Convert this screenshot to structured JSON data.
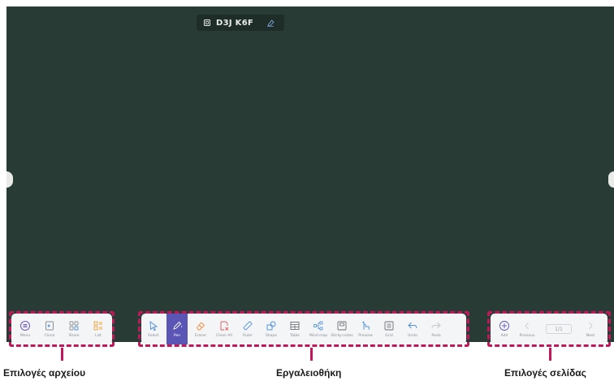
{
  "room": {
    "code": "D3J K6F",
    "code_icon": "copy-icon",
    "edit_icon": "eraser-icon"
  },
  "file_options": {
    "items": [
      {
        "label": "Menu",
        "icon": "menu-icon"
      },
      {
        "label": "Clone",
        "icon": "clone-icon"
      },
      {
        "label": "Share",
        "icon": "share-icon"
      },
      {
        "label": "List",
        "icon": "list-icon"
      }
    ]
  },
  "toolbox": {
    "items": [
      {
        "label": "Select",
        "icon": "cursor-icon"
      },
      {
        "label": "Pen",
        "icon": "pen-icon",
        "active": true
      },
      {
        "label": "Eraser",
        "icon": "eraser-icon"
      },
      {
        "label": "Clean All",
        "icon": "clean-all-icon"
      },
      {
        "label": "Ruler",
        "icon": "ruler-icon"
      },
      {
        "label": "Shape",
        "icon": "shape-icon"
      },
      {
        "label": "Table",
        "icon": "table-icon"
      },
      {
        "label": "Mind map",
        "icon": "mind-map-icon"
      },
      {
        "label": "Sticky-notes",
        "icon": "sticky-notes-icon"
      },
      {
        "label": "Preview",
        "icon": "preview-icon"
      },
      {
        "label": "Grid",
        "icon": "grid-icon"
      },
      {
        "label": "Undo",
        "icon": "undo-icon"
      },
      {
        "label": "Redo",
        "icon": "redo-icon"
      }
    ]
  },
  "page_options": {
    "add_label": "Add",
    "previous_label": "Previous",
    "page_indicator": "1/1",
    "next_label": "Next"
  },
  "callouts": {
    "file": "Επιλογές αρχείου",
    "toolbox": "Εργαλειοθήκη",
    "page": "Επιλογές σελίδας"
  },
  "colors": {
    "board": "#293b35",
    "accent": "#5b56b6",
    "highlight": "#c2185b",
    "icon_blue": "#4a8fd9",
    "icon_orange": "#f08a3c"
  }
}
